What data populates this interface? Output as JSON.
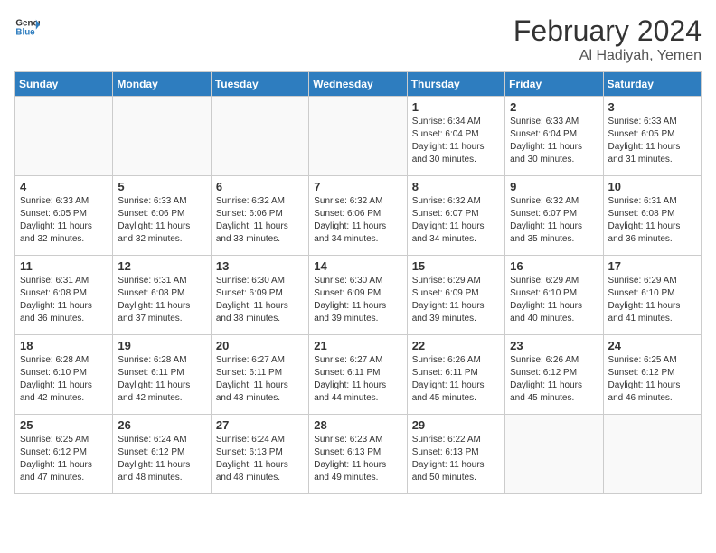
{
  "header": {
    "logo_line1": "General",
    "logo_line2": "Blue",
    "month_year": "February 2024",
    "location": "Al Hadiyah, Yemen"
  },
  "days_of_week": [
    "Sunday",
    "Monday",
    "Tuesday",
    "Wednesday",
    "Thursday",
    "Friday",
    "Saturday"
  ],
  "weeks": [
    [
      {
        "day": "",
        "info": ""
      },
      {
        "day": "",
        "info": ""
      },
      {
        "day": "",
        "info": ""
      },
      {
        "day": "",
        "info": ""
      },
      {
        "day": "1",
        "info": "Sunrise: 6:34 AM\nSunset: 6:04 PM\nDaylight: 11 hours and 30 minutes."
      },
      {
        "day": "2",
        "info": "Sunrise: 6:33 AM\nSunset: 6:04 PM\nDaylight: 11 hours and 30 minutes."
      },
      {
        "day": "3",
        "info": "Sunrise: 6:33 AM\nSunset: 6:05 PM\nDaylight: 11 hours and 31 minutes."
      }
    ],
    [
      {
        "day": "4",
        "info": "Sunrise: 6:33 AM\nSunset: 6:05 PM\nDaylight: 11 hours and 32 minutes."
      },
      {
        "day": "5",
        "info": "Sunrise: 6:33 AM\nSunset: 6:06 PM\nDaylight: 11 hours and 32 minutes."
      },
      {
        "day": "6",
        "info": "Sunrise: 6:32 AM\nSunset: 6:06 PM\nDaylight: 11 hours and 33 minutes."
      },
      {
        "day": "7",
        "info": "Sunrise: 6:32 AM\nSunset: 6:06 PM\nDaylight: 11 hours and 34 minutes."
      },
      {
        "day": "8",
        "info": "Sunrise: 6:32 AM\nSunset: 6:07 PM\nDaylight: 11 hours and 34 minutes."
      },
      {
        "day": "9",
        "info": "Sunrise: 6:32 AM\nSunset: 6:07 PM\nDaylight: 11 hours and 35 minutes."
      },
      {
        "day": "10",
        "info": "Sunrise: 6:31 AM\nSunset: 6:08 PM\nDaylight: 11 hours and 36 minutes."
      }
    ],
    [
      {
        "day": "11",
        "info": "Sunrise: 6:31 AM\nSunset: 6:08 PM\nDaylight: 11 hours and 36 minutes."
      },
      {
        "day": "12",
        "info": "Sunrise: 6:31 AM\nSunset: 6:08 PM\nDaylight: 11 hours and 37 minutes."
      },
      {
        "day": "13",
        "info": "Sunrise: 6:30 AM\nSunset: 6:09 PM\nDaylight: 11 hours and 38 minutes."
      },
      {
        "day": "14",
        "info": "Sunrise: 6:30 AM\nSunset: 6:09 PM\nDaylight: 11 hours and 39 minutes."
      },
      {
        "day": "15",
        "info": "Sunrise: 6:29 AM\nSunset: 6:09 PM\nDaylight: 11 hours and 39 minutes."
      },
      {
        "day": "16",
        "info": "Sunrise: 6:29 AM\nSunset: 6:10 PM\nDaylight: 11 hours and 40 minutes."
      },
      {
        "day": "17",
        "info": "Sunrise: 6:29 AM\nSunset: 6:10 PM\nDaylight: 11 hours and 41 minutes."
      }
    ],
    [
      {
        "day": "18",
        "info": "Sunrise: 6:28 AM\nSunset: 6:10 PM\nDaylight: 11 hours and 42 minutes."
      },
      {
        "day": "19",
        "info": "Sunrise: 6:28 AM\nSunset: 6:11 PM\nDaylight: 11 hours and 42 minutes."
      },
      {
        "day": "20",
        "info": "Sunrise: 6:27 AM\nSunset: 6:11 PM\nDaylight: 11 hours and 43 minutes."
      },
      {
        "day": "21",
        "info": "Sunrise: 6:27 AM\nSunset: 6:11 PM\nDaylight: 11 hours and 44 minutes."
      },
      {
        "day": "22",
        "info": "Sunrise: 6:26 AM\nSunset: 6:11 PM\nDaylight: 11 hours and 45 minutes."
      },
      {
        "day": "23",
        "info": "Sunrise: 6:26 AM\nSunset: 6:12 PM\nDaylight: 11 hours and 45 minutes."
      },
      {
        "day": "24",
        "info": "Sunrise: 6:25 AM\nSunset: 6:12 PM\nDaylight: 11 hours and 46 minutes."
      }
    ],
    [
      {
        "day": "25",
        "info": "Sunrise: 6:25 AM\nSunset: 6:12 PM\nDaylight: 11 hours and 47 minutes."
      },
      {
        "day": "26",
        "info": "Sunrise: 6:24 AM\nSunset: 6:12 PM\nDaylight: 11 hours and 48 minutes."
      },
      {
        "day": "27",
        "info": "Sunrise: 6:24 AM\nSunset: 6:13 PM\nDaylight: 11 hours and 48 minutes."
      },
      {
        "day": "28",
        "info": "Sunrise: 6:23 AM\nSunset: 6:13 PM\nDaylight: 11 hours and 49 minutes."
      },
      {
        "day": "29",
        "info": "Sunrise: 6:22 AM\nSunset: 6:13 PM\nDaylight: 11 hours and 50 minutes."
      },
      {
        "day": "",
        "info": ""
      },
      {
        "day": "",
        "info": ""
      }
    ]
  ]
}
